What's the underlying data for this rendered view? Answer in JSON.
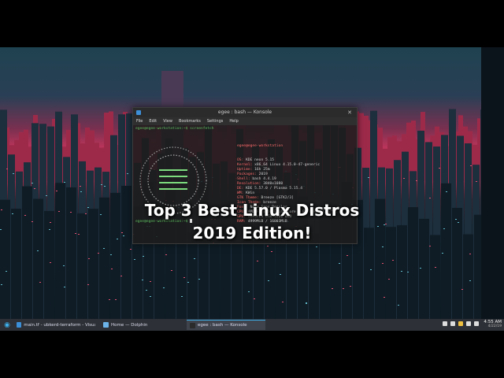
{
  "overlay": {
    "line1": "Top 3 Best Linux Distros",
    "line2": "2019 Edition!"
  },
  "konsole": {
    "title": "egee : bash — Konsole",
    "menu": [
      "File",
      "Edit",
      "View",
      "Bookmarks",
      "Settings",
      "Help"
    ],
    "command_line": "egee@egee-workstation:~$ screenfetch",
    "bottom_prompt": "egee@egee-workstation:~$ ",
    "info_header": "egee@egee-workstation",
    "info": [
      {
        "k": "OS:",
        "v": " KDE neon 5.15"
      },
      {
        "k": "Kernel:",
        "v": " x86_64 Linux 4.15.0-47-generic"
      },
      {
        "k": "Uptime:",
        "v": " 16h 25m"
      },
      {
        "k": "Packages:",
        "v": " 2019"
      },
      {
        "k": "Shell:",
        "v": " bash 4.4.19"
      },
      {
        "k": "Resolution:",
        "v": " 3840x1080"
      },
      {
        "k": "DE:",
        "v": " KDE 5.57.0 / Plasma 5.15.4"
      },
      {
        "k": "WM:",
        "v": " KWin"
      },
      {
        "k": "GTK Theme:",
        "v": " Breeze [GTK2/3]"
      },
      {
        "k": "Icon Theme:",
        "v": " breeze"
      },
      {
        "k": "Font:",
        "v": " Noto Sans Regular"
      },
      {
        "k": "CPU:",
        "v": " AMD FX-8350 Eight-Core @ 8x 4GHz [21.2°C]"
      },
      {
        "k": "GPU:",
        "v": " GeForce GTX 1060 6GB"
      },
      {
        "k": "RAM:",
        "v": " 4999MiB / 16003MiB"
      }
    ]
  },
  "taskbar": {
    "tasks": [
      {
        "label": "main.tf - ubkerd-terraform - Visual ...",
        "color": "#3b8ed8",
        "active": false
      },
      {
        "label": "Home — Dolphin",
        "color": "#6bb3e8",
        "active": false
      },
      {
        "label": "egee : bash — Konsole",
        "color": "#2b2b2b",
        "active": true
      }
    ],
    "time": "4:55 AM",
    "date": "4/22/19",
    "tray_icons": [
      "network-icon",
      "volume-icon",
      "updates-icon",
      "clipboard-icon",
      "notifications-icon"
    ]
  }
}
